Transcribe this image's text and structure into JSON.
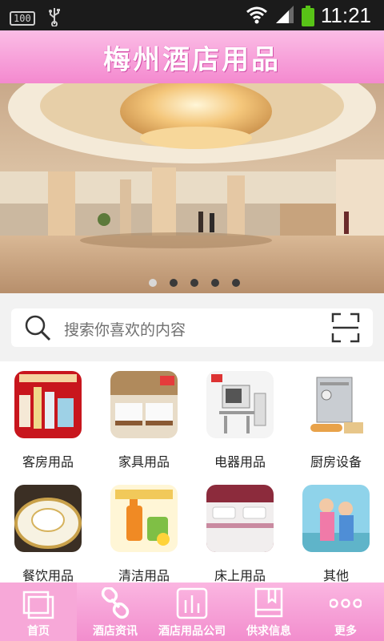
{
  "status_bar": {
    "battery_badge": "100",
    "time": "11:21",
    "icons": [
      "usb-icon",
      "wifi-icon",
      "signal-icon",
      "battery-icon"
    ]
  },
  "header": {
    "title": "梅州酒店用品"
  },
  "banner": {
    "image": "hotel-lobby-image",
    "slide_count": 5,
    "active_slide": 1
  },
  "search": {
    "placeholder": "搜索你喜欢的内容"
  },
  "categories": [
    {
      "label": "客房用品",
      "image": "guest-room-products-image"
    },
    {
      "label": "家具用品",
      "image": "furniture-image"
    },
    {
      "label": "电器用品",
      "image": "appliances-image"
    },
    {
      "label": "厨房设备",
      "image": "kitchen-equipment-image"
    },
    {
      "label": "餐饮用品",
      "image": "tableware-image"
    },
    {
      "label": "清洁用品",
      "image": "cleaning-products-image"
    },
    {
      "label": "床上用品",
      "image": "bedding-image"
    },
    {
      "label": "其他",
      "image": "other-image"
    }
  ],
  "tabs": [
    {
      "label": "首页",
      "icon": "home-icon",
      "active": true
    },
    {
      "label": "酒店资讯",
      "icon": "link-icon",
      "active": false
    },
    {
      "label": "酒店用品公司",
      "icon": "chart-icon",
      "active": false
    },
    {
      "label": "供求信息",
      "icon": "book-icon",
      "active": false
    },
    {
      "label": "更多",
      "icon": "more-icon",
      "active": false
    }
  ],
  "colors": {
    "brand_pink": "#f489cf",
    "tab_pink": "#f28dcd",
    "battery_green": "#58c317"
  }
}
